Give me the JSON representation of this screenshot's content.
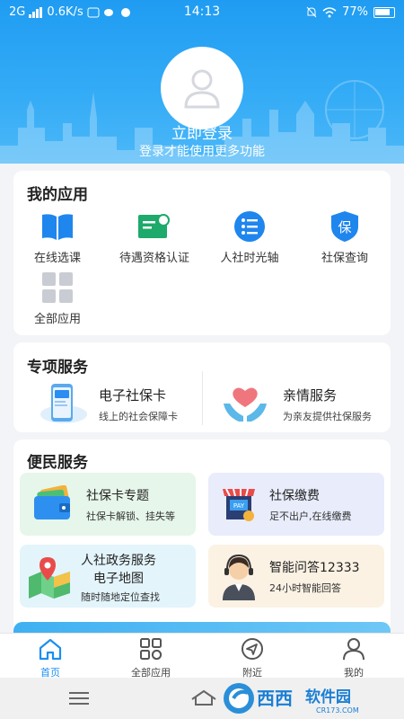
{
  "status_bar": {
    "network": "2G",
    "speed": "0.6K/s",
    "time": "14:13",
    "battery": "77%"
  },
  "header": {
    "login_title": "立即登录",
    "login_subtitle": "登录才能使用更多功能"
  },
  "my_apps": {
    "title": "我的应用",
    "items": [
      {
        "label": "在线选课",
        "icon": "book-icon"
      },
      {
        "label": "待遇资格认证",
        "icon": "certificate-icon"
      },
      {
        "label": "人社时光轴",
        "icon": "timeline-icon"
      },
      {
        "label": "社保查询",
        "icon": "shield-bao-icon"
      },
      {
        "label": "全部应用",
        "icon": "grid-icon"
      }
    ]
  },
  "special": {
    "title": "专项服务",
    "items": [
      {
        "name": "电子社保卡",
        "desc": "线上的社会保障卡",
        "icon": "phone-card-icon"
      },
      {
        "name": "亲情服务",
        "desc": "为亲友提供社保服务",
        "icon": "heart-hands-icon"
      }
    ]
  },
  "convenience": {
    "title": "便民服务",
    "tiles": [
      {
        "name": "社保卡专题",
        "desc": "社保卡解锁、挂失等",
        "icon": "wallet-cards-icon",
        "bg": "#e6f6ea"
      },
      {
        "name": "社保缴费",
        "desc": "足不出户,在线缴费",
        "icon": "pay-store-icon",
        "bg": "#e8ecfb"
      },
      {
        "name_line1": "人社政务服务",
        "name_line2": "电子地图",
        "desc": "随时随地定位查找",
        "icon": "map-pin-icon",
        "bg": "#e3f4fb"
      },
      {
        "name": "智能问答12333",
        "desc": "24小时智能回答",
        "icon": "customer-service-icon",
        "bg": "#fbf2e4"
      }
    ]
  },
  "bottom_nav": [
    {
      "label": "首页",
      "icon": "home-icon",
      "active": true
    },
    {
      "label": "全部应用",
      "icon": "apps-grid-icon",
      "active": false
    },
    {
      "label": "附近",
      "icon": "location-arrow-icon",
      "active": false
    },
    {
      "label": "我的",
      "icon": "person-icon",
      "active": false
    }
  ],
  "watermark": {
    "brand": "西西",
    "site": "软件园",
    "url": "CR173.COM"
  },
  "colors": {
    "primary": "#1b8ff0",
    "header": "#2aa6f5"
  }
}
